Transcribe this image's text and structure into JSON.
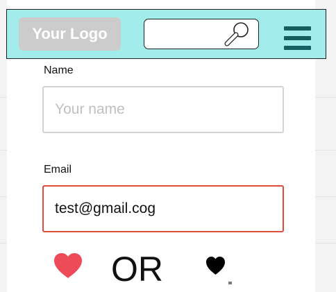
{
  "header": {
    "logo_text": "Your Logo",
    "colors": {
      "background": "#a3ecec",
      "border": "#1f1f1f",
      "menu": "#145f5f"
    },
    "search": {
      "value": "",
      "placeholder": "",
      "icon": "magnifier-icon"
    },
    "menu_icon": "hamburger-menu-icon"
  },
  "form": {
    "name": {
      "label": "Name",
      "value": "",
      "placeholder": "Your name",
      "border_color": "#d3d3d3"
    },
    "email": {
      "label": "Email",
      "value": "test@gmail.cog",
      "placeholder": "",
      "border_color": "#e04b3c"
    }
  },
  "choices": {
    "left_icon": "red-heart-icon",
    "left_color": "#ee4b58",
    "separator": "OR",
    "right_icon": "black-heart-icon",
    "right_color": "#000000"
  }
}
